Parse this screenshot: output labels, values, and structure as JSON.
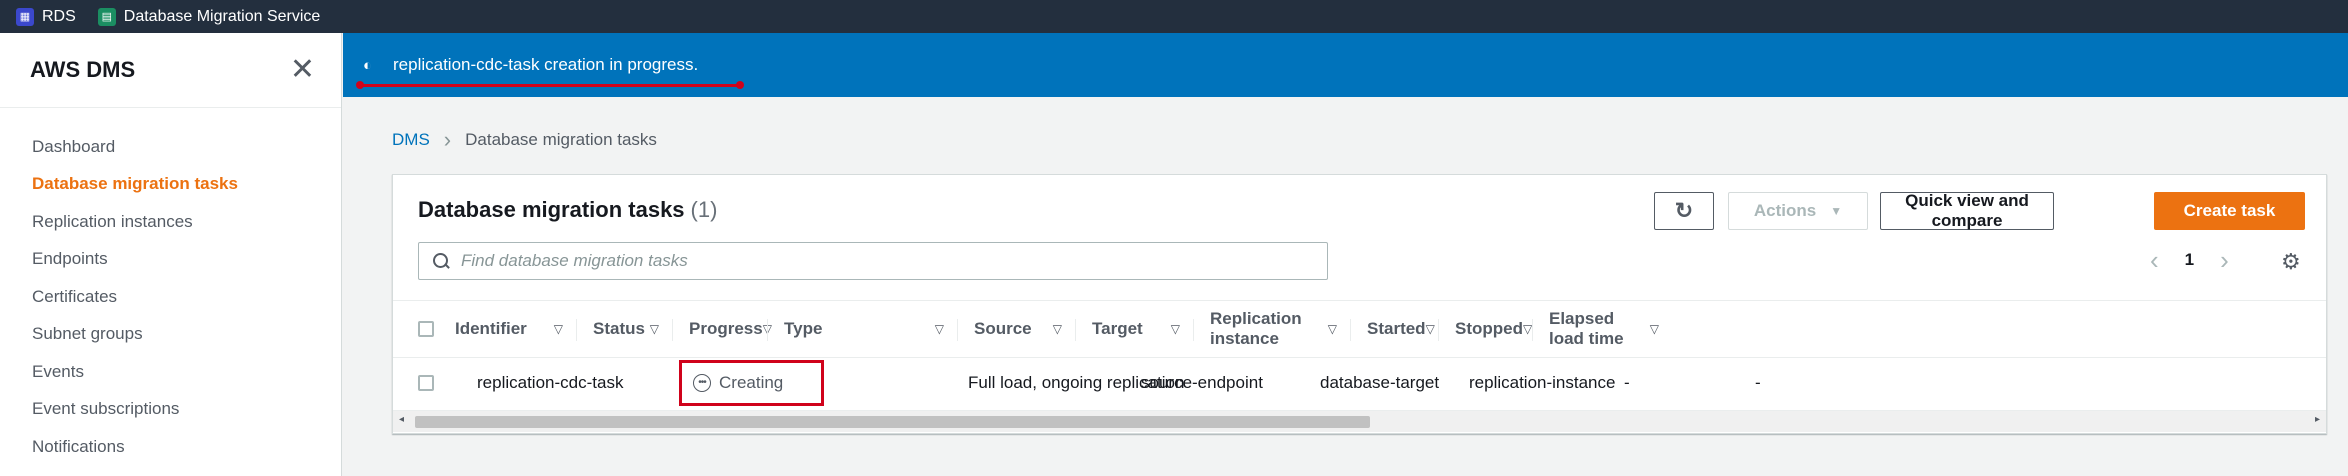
{
  "topbar": {
    "items": [
      {
        "label": "RDS",
        "icon": "rds-icon"
      },
      {
        "label": "Database Migration Service",
        "icon": "dms-icon"
      }
    ]
  },
  "sidebar": {
    "title": "AWS DMS",
    "items": [
      {
        "label": "Dashboard",
        "active": false
      },
      {
        "label": "Database migration tasks",
        "active": true
      },
      {
        "label": "Replication instances",
        "active": false
      },
      {
        "label": "Endpoints",
        "active": false
      },
      {
        "label": "Certificates",
        "active": false
      },
      {
        "label": "Subnet groups",
        "active": false
      },
      {
        "label": "Events",
        "active": false
      },
      {
        "label": "Event subscriptions",
        "active": false
      },
      {
        "label": "Notifications",
        "active": false
      }
    ]
  },
  "flash": {
    "message": "replication-cdc-task creation in progress.",
    "color": "#0073bb"
  },
  "breadcrumb": {
    "root": "DMS",
    "current": "Database migration tasks"
  },
  "panel": {
    "title": "Database migration tasks",
    "count": "(1)",
    "actions_label": "Actions",
    "compare_label": "Quick view and compare",
    "create_label": "Create task",
    "search_placeholder": "Find database migration tasks",
    "page": "1"
  },
  "table": {
    "columns": [
      "Identifier",
      "Status",
      "Progress",
      "Type",
      "Source",
      "Target",
      "Replication instance",
      "Started",
      "Stopped",
      "Elapsed load time"
    ],
    "rows": [
      {
        "identifier": "replication-cdc-task",
        "status": "Creating",
        "progress": "",
        "type": "Full load, ongoing replication",
        "source": "source-endpoint",
        "target": "database-target",
        "replication_instance": "replication-instance",
        "started": "-",
        "stopped": "-",
        "elapsed": ""
      }
    ]
  },
  "colors": {
    "accent": "#ec7211",
    "link": "#0073bb",
    "highlight": "#d0021b"
  }
}
